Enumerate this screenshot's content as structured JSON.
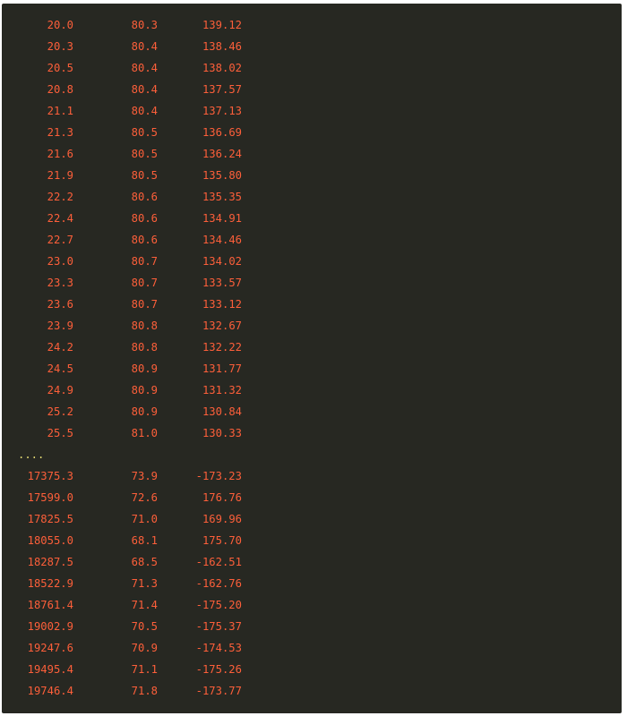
{
  "output": {
    "rows_top": [
      [
        "20.0",
        "80.3",
        "139.12"
      ],
      [
        "20.3",
        "80.4",
        "138.46"
      ],
      [
        "20.5",
        "80.4",
        "138.02"
      ],
      [
        "20.8",
        "80.4",
        "137.57"
      ],
      [
        "21.1",
        "80.4",
        "137.13"
      ],
      [
        "21.3",
        "80.5",
        "136.69"
      ],
      [
        "21.6",
        "80.5",
        "136.24"
      ],
      [
        "21.9",
        "80.5",
        "135.80"
      ],
      [
        "22.2",
        "80.6",
        "135.35"
      ],
      [
        "22.4",
        "80.6",
        "134.91"
      ],
      [
        "22.7",
        "80.6",
        "134.46"
      ],
      [
        "23.0",
        "80.7",
        "134.02"
      ],
      [
        "23.3",
        "80.7",
        "133.57"
      ],
      [
        "23.6",
        "80.7",
        "133.12"
      ],
      [
        "23.9",
        "80.8",
        "132.67"
      ],
      [
        "24.2",
        "80.8",
        "132.22"
      ],
      [
        "24.5",
        "80.9",
        "131.77"
      ],
      [
        "24.9",
        "80.9",
        "131.32"
      ],
      [
        "25.2",
        "80.9",
        "130.84"
      ],
      [
        "25.5",
        "81.0",
        "130.33"
      ]
    ],
    "ellipsis": "....",
    "rows_bottom": [
      [
        "17375.3",
        "73.9",
        "-173.23"
      ],
      [
        "17599.0",
        "72.6",
        "176.76"
      ],
      [
        "17825.5",
        "71.0",
        "169.96"
      ],
      [
        "18055.0",
        "68.1",
        "175.70"
      ],
      [
        "18287.5",
        "68.5",
        "-162.51"
      ],
      [
        "18522.9",
        "71.3",
        "-162.76"
      ],
      [
        "18761.4",
        "71.4",
        "-175.20"
      ],
      [
        "19002.9",
        "70.5",
        "-175.37"
      ],
      [
        "19247.6",
        "70.9",
        "-174.53"
      ],
      [
        "19495.4",
        "71.1",
        "-175.26"
      ],
      [
        "19746.4",
        "71.8",
        "-173.77"
      ]
    ]
  },
  "colors": {
    "background": "#272822",
    "number_text": "#fd5f3a",
    "ellipsis_text": "#e6db74"
  }
}
